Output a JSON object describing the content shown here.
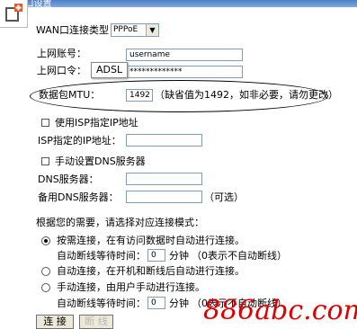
{
  "window": {
    "title": "WAN口设置"
  },
  "form": {
    "wan_type_label": "WAN口连接类型：",
    "wan_type_value": "PPPoE",
    "account_label": "上网账号：",
    "account_value": "username",
    "password_label": "上网口令：",
    "password_value": "*************",
    "tooltip": "ADSL",
    "mtu_label": "数据包MTU：",
    "mtu_value": "1492",
    "mtu_hint": "（缺省值为1492，如非必要，请勿更改）",
    "use_isp_ip_label": "使用ISP指定IP地址",
    "isp_ip_label": "ISP指定的IP地址：",
    "manual_dns_label": "手动设置DNS服务器",
    "dns_label": "DNS服务器：",
    "backup_dns_label": "备用DNS服务器：",
    "optional_note": "（可选）",
    "mode_prompt": "根据您的需要，请选择对应连接模式：",
    "mode_on_demand": "按需连接，在有访问数据时自动进行连接。",
    "idle_label": "自动断线等待时间：",
    "idle_value_1": "0",
    "minutes": "分钟",
    "idle_note": "（0表示不自动断线）",
    "mode_auto": "自动连接，在开机和断线后自动进行连接。",
    "mode_manual": "手动连接，由用户手动进行连接。",
    "idle_value_2": "0",
    "connect_button": "连 接",
    "disconnect_button": "断 线"
  },
  "watermark": "886abc.com"
}
